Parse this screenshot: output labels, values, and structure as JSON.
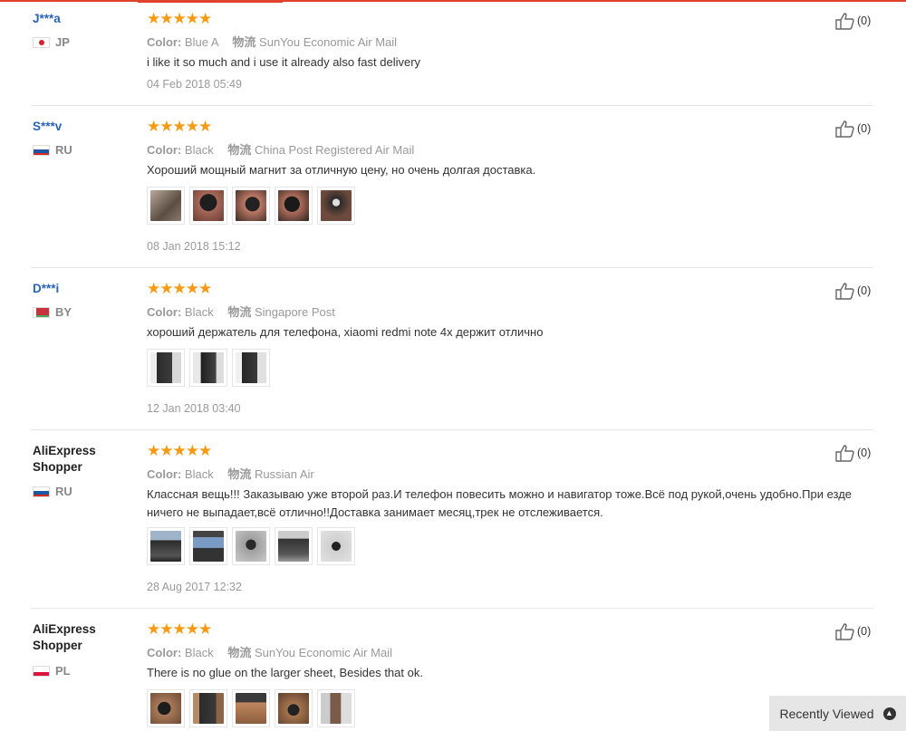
{
  "colors": {
    "accent": "#e0412c",
    "star": "#f59a12",
    "username": "#2962b7"
  },
  "reviews": [
    {
      "user": "J***a",
      "country": "JP",
      "stars": "★★★★★",
      "color_label": "Color:",
      "color_value": "Blue A",
      "logistics_label": "物流",
      "logistics_value": "SunYou Economic Air Mail",
      "text": "i like it so much and i use it already also fast delivery",
      "date": "04 Feb 2018 05:49",
      "likes": "(0)"
    },
    {
      "user": "S***v",
      "country": "RU",
      "stars": "★★★★★",
      "color_label": "Color:",
      "color_value": "Black",
      "logistics_label": "物流",
      "logistics_value": "China Post Registered Air Mail",
      "text": "Хороший мощный магнит за отличную цену, но очень долгая доставка.",
      "date": "08 Jan 2018 15:12",
      "likes": "(0)"
    },
    {
      "user": "D***i",
      "country": "BY",
      "stars": "★★★★★",
      "color_label": "Color:",
      "color_value": "Black",
      "logistics_label": "物流",
      "logistics_value": "Singapore Post",
      "text": "хороший держатель для телефона, xiaomi redmi note 4x держит отлично",
      "date": "12 Jan 2018 03:40",
      "likes": "(0)"
    },
    {
      "user": "AliExpress Shopper",
      "country": "RU",
      "stars": "★★★★★",
      "color_label": "Color:",
      "color_value": "Black",
      "logistics_label": "物流",
      "logistics_value": "Russian Air",
      "text": "Классная вещь!!! Заказываю уже второй раз.И телефон повесить можно и навигатор тоже.Всё под рукой,очень удобно.При езде ничего не выпадает,всё отлично!!Доставка занимает месяц,трек не отслеживается.",
      "date": "28 Aug 2017 12:32",
      "likes": "(0)"
    },
    {
      "user": "AliExpress Shopper",
      "country": "PL",
      "stars": "★★★★★",
      "color_label": "Color:",
      "color_value": "Black",
      "logistics_label": "物流",
      "logistics_value": "SunYou Economic Air Mail",
      "text": "There is no glue on the larger sheet, Besides that ok.",
      "date": "",
      "likes": "(0)"
    }
  ],
  "recently_viewed": {
    "label": "Recently Viewed",
    "icon": "chevron-up-icon"
  }
}
